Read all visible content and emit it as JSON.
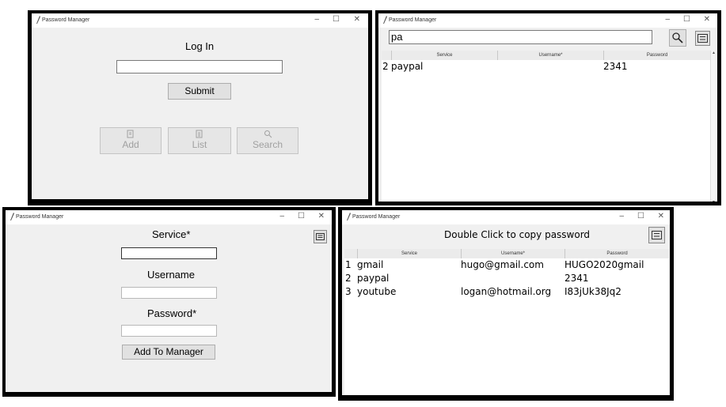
{
  "app": {
    "window_title": "Password Manager"
  },
  "window_controls": {
    "minimize": "–",
    "maximize": "☐",
    "close": "✕"
  },
  "login": {
    "heading": "Log In",
    "submit_label": "Submit",
    "add_label": "Add",
    "list_label": "List",
    "search_label": "Search"
  },
  "search": {
    "query": "pa",
    "columns": [
      "Service",
      "Username*",
      "Password"
    ],
    "rows": [
      {
        "index": "2",
        "service": "paypal",
        "username": "",
        "password": "2341"
      }
    ]
  },
  "add": {
    "service_label": "Service*",
    "username_label": "Username",
    "password_label": "Password*",
    "add_button_label": "Add To Manager"
  },
  "list": {
    "heading": "Double Click to copy password",
    "columns": [
      "Service",
      "Username*",
      "Password"
    ],
    "rows": [
      {
        "index": "1",
        "service": "gmail",
        "username": "hugo@gmail.com",
        "password": "HUGO2020gmail"
      },
      {
        "index": "2",
        "service": "paypal",
        "username": "",
        "password": "2341"
      },
      {
        "index": "3",
        "service": "youtube",
        "username": "logan@hotmail.org",
        "password": "I83jUk38Jq2"
      }
    ]
  }
}
